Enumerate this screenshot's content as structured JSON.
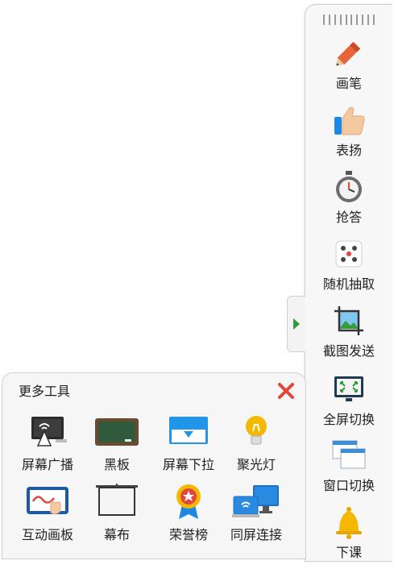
{
  "toolbar": {
    "tools": [
      {
        "label": "画笔",
        "icon": "pencil-icon"
      },
      {
        "label": "表扬",
        "icon": "thumbs-up-icon"
      },
      {
        "label": "抢答",
        "icon": "stopwatch-icon"
      },
      {
        "label": "随机抽取",
        "icon": "dice-icon"
      },
      {
        "label": "截图发送",
        "icon": "screenshot-icon"
      },
      {
        "label": "全屏切换",
        "icon": "fullscreen-icon"
      },
      {
        "label": "窗口切换",
        "icon": "window-switch-icon"
      },
      {
        "label": "下课",
        "icon": "bell-icon"
      }
    ]
  },
  "more_tools": {
    "title": "更多工具",
    "close_icon": "close-icon",
    "items": [
      {
        "label": "屏幕广播",
        "icon": "screen-broadcast-icon"
      },
      {
        "label": "黑板",
        "icon": "blackboard-icon"
      },
      {
        "label": "屏幕下拉",
        "icon": "screen-pulldown-icon"
      },
      {
        "label": "聚光灯",
        "icon": "spotlight-icon"
      },
      {
        "label": "互动画板",
        "icon": "interactive-board-icon"
      },
      {
        "label": "幕布",
        "icon": "curtain-icon"
      },
      {
        "label": "荣誉榜",
        "icon": "honor-badge-icon"
      },
      {
        "label": "同屏连接",
        "icon": "screen-mirror-icon"
      }
    ]
  },
  "colors": {
    "accent_green": "#2e9b3a",
    "close_red": "#e0463a",
    "pencil_orange": "#e8643a"
  }
}
